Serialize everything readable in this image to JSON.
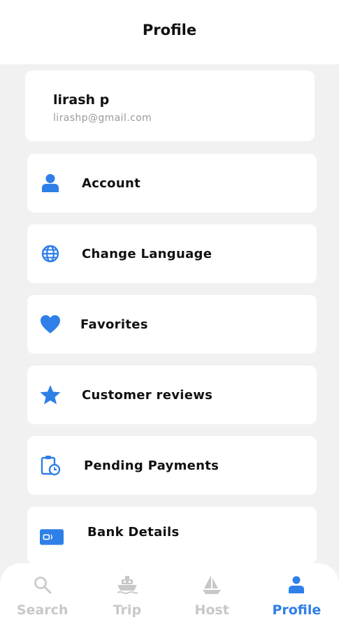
{
  "header": {
    "title": "Profile"
  },
  "user": {
    "name": "lirash p",
    "email": "lirashp@gmail.com"
  },
  "menu": [
    {
      "label": "Account",
      "icon": "person-icon"
    },
    {
      "label": "Change Language",
      "icon": "globe-icon"
    },
    {
      "label": "Favorites",
      "icon": "heart-icon"
    },
    {
      "label": "Customer reviews",
      "icon": "star-icon"
    },
    {
      "label": "Pending Payments",
      "icon": "clipboard-clock-icon"
    },
    {
      "label": "Bank Details",
      "icon": "card-icon"
    }
  ],
  "tabs": [
    {
      "label": "Search",
      "icon": "search-icon",
      "active": false
    },
    {
      "label": "Trip",
      "icon": "ship-icon",
      "active": false
    },
    {
      "label": "Host",
      "icon": "sailboat-icon",
      "active": false
    },
    {
      "label": "Profile",
      "icon": "person-icon",
      "active": true
    }
  ],
  "colors": {
    "accent": "#2f7fe8",
    "inactive": "#c8c8c8",
    "background": "#f1f1f1"
  }
}
